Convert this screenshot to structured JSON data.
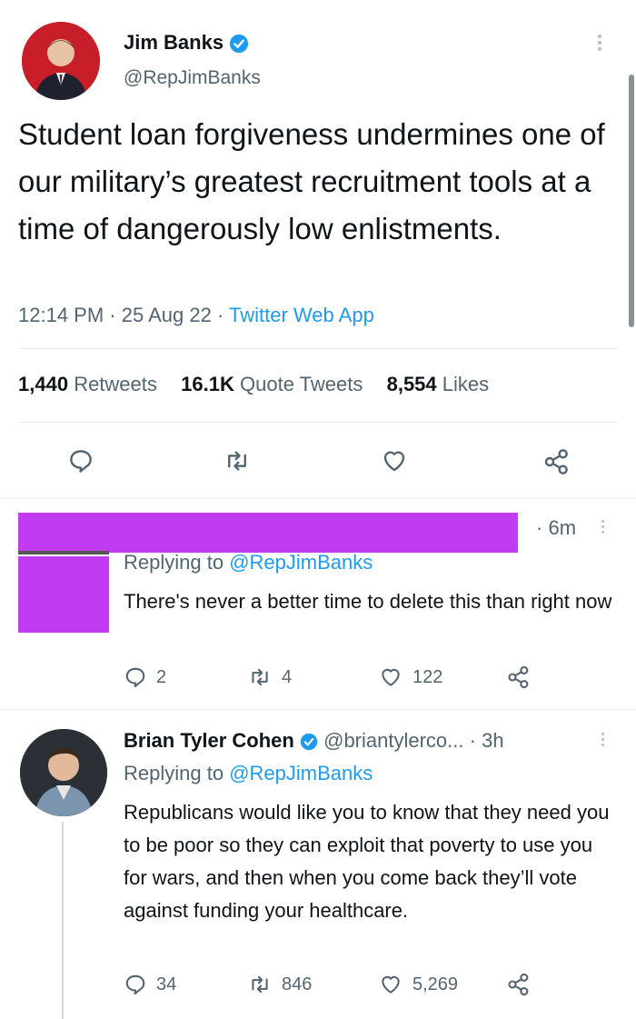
{
  "main_tweet": {
    "author_name": "Jim Banks",
    "author_handle": "@RepJimBanks",
    "text": "Student loan forgiveness undermines one of our military’s greatest recruitment tools at a time of dangerously low enlistments.",
    "time": "12:14 PM",
    "date": "25 Aug 22",
    "source": "Twitter Web App",
    "stats": {
      "retweets_count": "1,440",
      "retweets_label": "Retweets",
      "quotes_count": "16.1K",
      "quotes_label": "Quote Tweets",
      "likes_count": "8,554",
      "likes_label": "Likes"
    }
  },
  "reply1": {
    "time": "6m",
    "replying_prefix": "Replying to",
    "replying_handle": "@RepJimBanks",
    "text": "There's never a better time to delete this than right now",
    "replies": "2",
    "retweets": "4",
    "likes": "122"
  },
  "reply2": {
    "author_name": "Brian Tyler Cohen",
    "author_handle": "@briantylerco...",
    "time": "3h",
    "replying_prefix": "Replying to",
    "replying_handle": "@RepJimBanks",
    "text": "Republicans would like you to know that they need you to be poor so they can exploit that poverty to use you for wars, and then when you come back they’ll vote against funding your healthcare.",
    "replies": "34",
    "retweets": "846",
    "likes": "5,269"
  },
  "colors": {
    "accent": "#1d9bf0",
    "redaction": "#c13cf0"
  }
}
